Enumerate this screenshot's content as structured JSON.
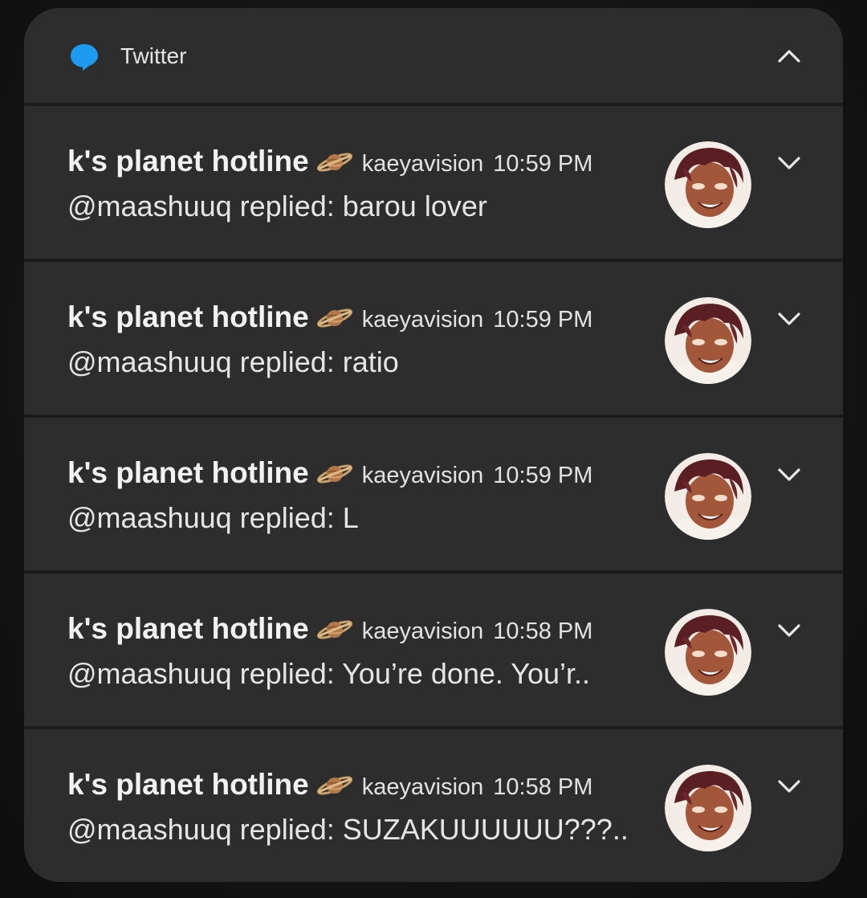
{
  "app": {
    "name": "Twitter",
    "accent_color": "#1d9bf0",
    "icon": "chat-bubble-icon",
    "collapse_icon": "chevron-up-icon"
  },
  "notifications": [
    {
      "sender": "k's planet hotline",
      "emoji_icon": "ringed-planet-icon",
      "handle": "kaeyavision",
      "time": "10:59 PM",
      "body": "@maashuuq replied: barou lover",
      "avatar": "anime-avatar",
      "expand_icon": "chevron-down-icon"
    },
    {
      "sender": "k's planet hotline",
      "emoji_icon": "ringed-planet-icon",
      "handle": "kaeyavision",
      "time": "10:59 PM",
      "body": "@maashuuq replied: ratio",
      "avatar": "anime-avatar",
      "expand_icon": "chevron-down-icon"
    },
    {
      "sender": "k's planet hotline",
      "emoji_icon": "ringed-planet-icon",
      "handle": "kaeyavision",
      "time": "10:59 PM",
      "body": "@maashuuq replied: L",
      "avatar": "anime-avatar",
      "expand_icon": "chevron-down-icon"
    },
    {
      "sender": "k's planet hotline",
      "emoji_icon": "ringed-planet-icon",
      "handle": "kaeyavision",
      "time": "10:58 PM",
      "body": "@maashuuq replied: You’re done. You’r..",
      "avatar": "anime-avatar",
      "expand_icon": "chevron-down-icon"
    },
    {
      "sender": "k's planet hotline",
      "emoji_icon": "ringed-planet-icon",
      "handle": "kaeyavision",
      "time": "10:58 PM",
      "body": "@maashuuq replied: SUZAKUUUUUU???..",
      "avatar": "anime-avatar",
      "expand_icon": "chevron-down-icon"
    }
  ]
}
